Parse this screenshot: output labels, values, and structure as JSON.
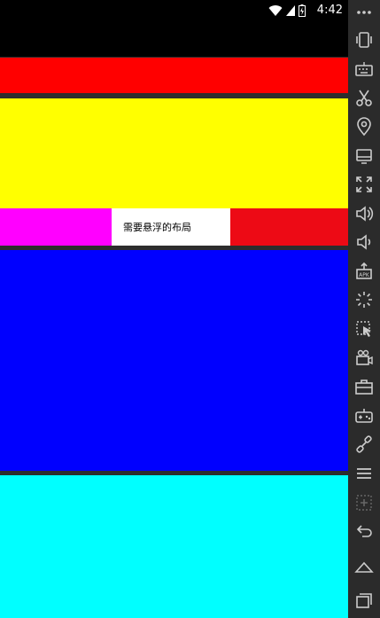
{
  "status_bar": {
    "time": "4:42"
  },
  "content": {
    "floating_label": "需要悬浮的布局"
  },
  "colors": {
    "status": "#000000",
    "top_black": "#000000",
    "red_block": "#ff0000",
    "yellow_block": "#ffff00",
    "magenta_cell": "#ff00ff",
    "floating_cell": "#ffffff",
    "red_cell": "#ed0a15",
    "blue_block": "#0000ff",
    "cyan_block": "#00ffff",
    "toolbar": "#2b2b2b"
  },
  "toolbar_icons": [
    "more-icon",
    "vibrate-icon",
    "keyboard-icon",
    "scissors-icon",
    "location-icon",
    "screen-icon",
    "fullscreen-icon",
    "volume-up-icon",
    "volume-down-icon",
    "apk-install-icon",
    "loading-icon",
    "shake-icon",
    "camera-icon",
    "toolbox-icon",
    "gamepad-icon",
    "link-icon",
    "menu-icon",
    "multi-window-icon",
    "back-icon",
    "home-icon",
    "recents-icon"
  ]
}
